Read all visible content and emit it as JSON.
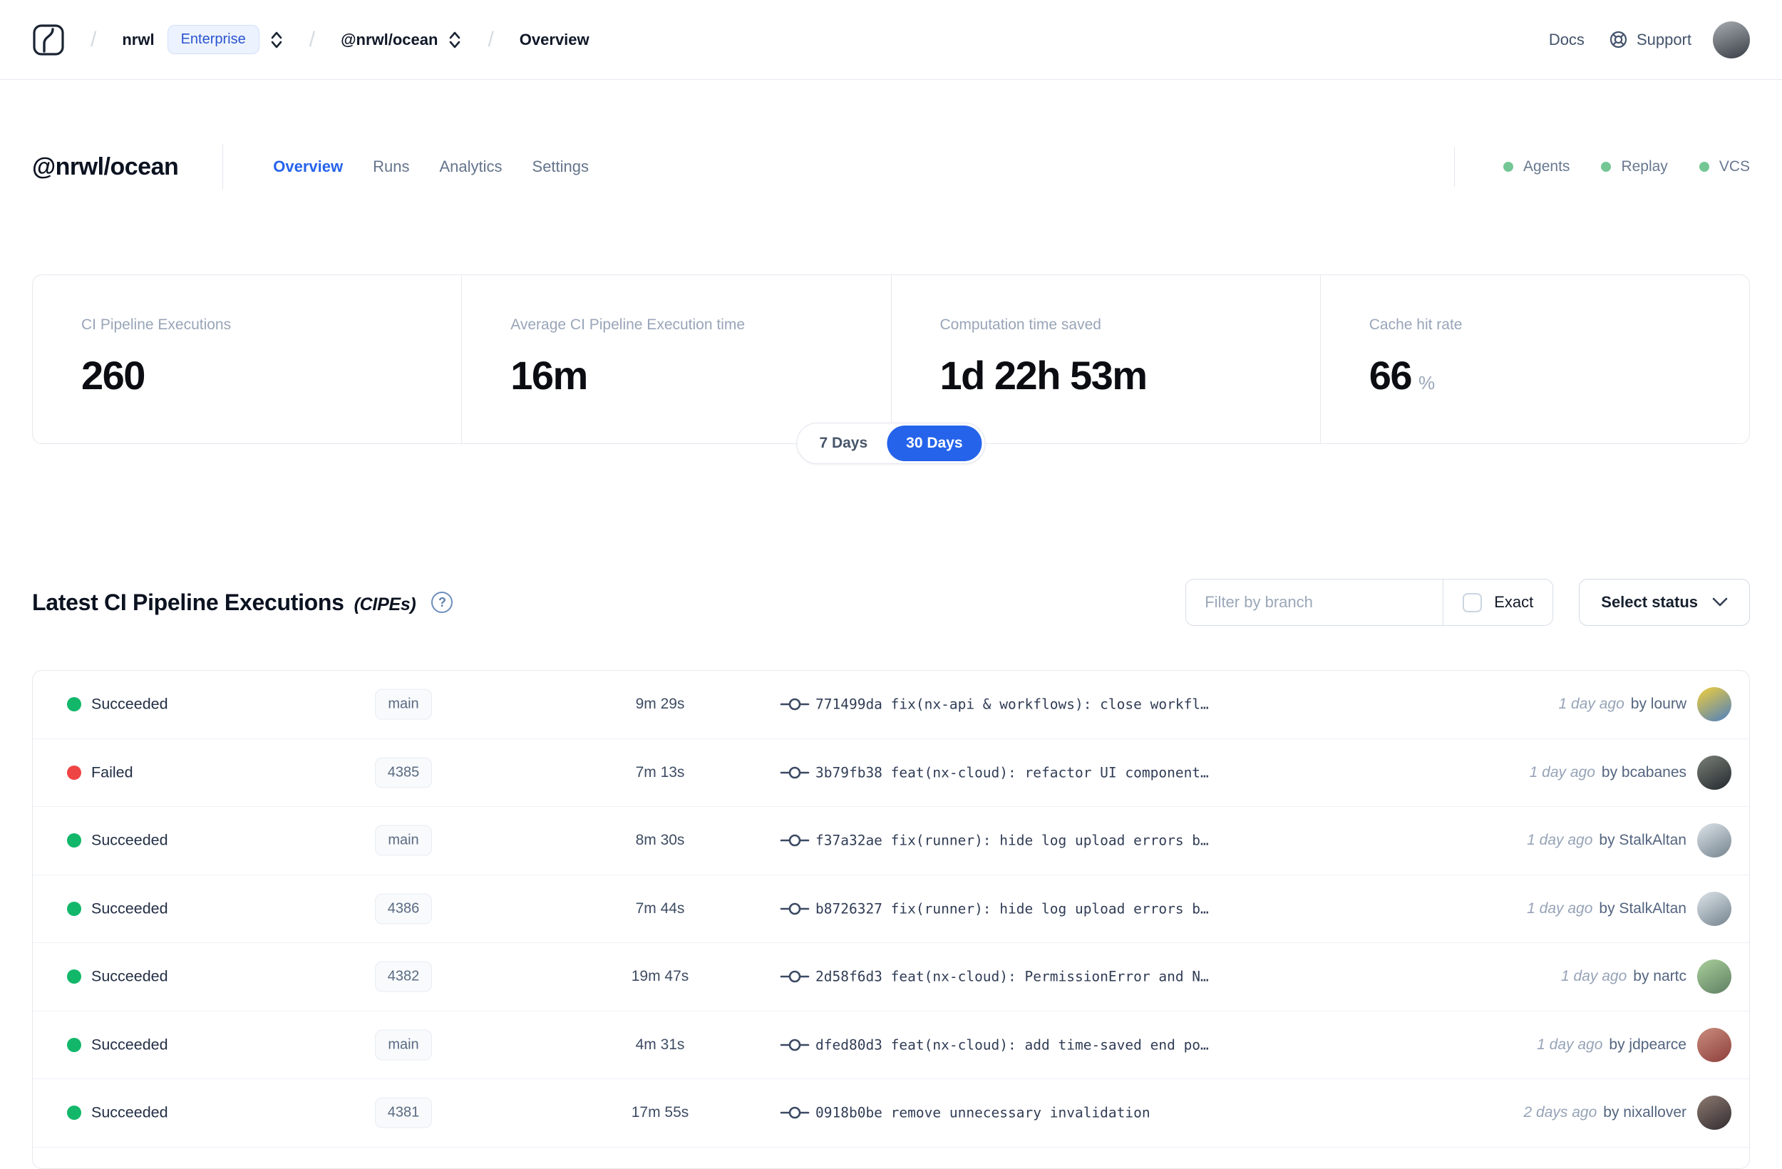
{
  "header": {
    "breadcrumb": {
      "separator": "/",
      "org": "nrwl",
      "org_badge": "Enterprise",
      "workspace": "@nrwl/ocean",
      "page": "Overview"
    },
    "docs_label": "Docs",
    "support_label": "Support",
    "avatar_colors": [
      "#a7acb1",
      "#383e45"
    ]
  },
  "workspace_header": {
    "title": "@nrwl/ocean",
    "tabs": [
      {
        "label": "Overview",
        "active": true
      },
      {
        "label": "Runs",
        "active": false
      },
      {
        "label": "Analytics",
        "active": false
      },
      {
        "label": "Settings",
        "active": false
      }
    ],
    "indicators": [
      {
        "label": "Agents"
      },
      {
        "label": "Replay"
      },
      {
        "label": "VCS"
      }
    ]
  },
  "stats": {
    "cards": [
      {
        "label": "CI Pipeline Executions",
        "value": "260",
        "suffix": ""
      },
      {
        "label": "Average CI Pipeline Execution time",
        "value": "16m",
        "suffix": ""
      },
      {
        "label": "Computation time saved",
        "value": "1d 22h 53m",
        "suffix": ""
      },
      {
        "label": "Cache hit rate",
        "value": "66",
        "suffix": "%"
      }
    ],
    "range_options": [
      "7 Days",
      "30 Days"
    ],
    "range_selected": "30 Days"
  },
  "cipe_section": {
    "title": "Latest CI Pipeline Executions",
    "title_suffix": "(CIPEs)",
    "help_icon": "?",
    "filter_placeholder": "Filter by branch",
    "exact_label": "Exact",
    "exact_checked": false,
    "status_dropdown_label": "Select status",
    "rows": [
      {
        "status": "Succeeded",
        "status_color": "green",
        "branch": "main",
        "duration": "9m 29s",
        "commit_hash": "771499da",
        "commit_message": "fix(nx-api & workflows): close workfl…",
        "time_ago": "1 day ago",
        "author": "by lourw",
        "avatar_colors": [
          "#f2cf3a",
          "#4c7ec2"
        ]
      },
      {
        "status": "Failed",
        "status_color": "red",
        "branch": "4385",
        "duration": "7m 13s",
        "commit_hash": "3b79fb38",
        "commit_message": "feat(nx-cloud): refactor UI component…",
        "time_ago": "1 day ago",
        "author": "by bcabanes",
        "avatar_colors": [
          "#7a8076",
          "#23282e"
        ]
      },
      {
        "status": "Succeeded",
        "status_color": "green",
        "branch": "main",
        "duration": "8m 30s",
        "commit_hash": "f37a32ae",
        "commit_message": "fix(runner): hide log upload errors b…",
        "time_ago": "1 day ago",
        "author": "by StalkAltan",
        "avatar_colors": [
          "#dde4e9",
          "#74838e"
        ]
      },
      {
        "status": "Succeeded",
        "status_color": "green",
        "branch": "4386",
        "duration": "7m 44s",
        "commit_hash": "b8726327",
        "commit_message": "fix(runner): hide log upload errors b…",
        "time_ago": "1 day ago",
        "author": "by StalkAltan",
        "avatar_colors": [
          "#dde4e9",
          "#74838e"
        ]
      },
      {
        "status": "Succeeded",
        "status_color": "green",
        "branch": "4382",
        "duration": "19m 47s",
        "commit_hash": "2d58f6d3",
        "commit_message": "feat(nx-cloud): PermissionError and N…",
        "time_ago": "1 day ago",
        "author": "by nartc",
        "avatar_colors": [
          "#a9cf9a",
          "#5f7f63"
        ]
      },
      {
        "status": "Succeeded",
        "status_color": "green",
        "branch": "main",
        "duration": "4m 31s",
        "commit_hash": "dfed80d3",
        "commit_message": "feat(nx-cloud): add time-saved end po…",
        "time_ago": "1 day ago",
        "author": "by jdpearce",
        "avatar_colors": [
          "#c98d7d",
          "#8e3f3c"
        ]
      },
      {
        "status": "Succeeded",
        "status_color": "green",
        "branch": "4381",
        "duration": "17m 55s",
        "commit_hash": "0918b0be",
        "commit_message": "remove unnecessary invalidation",
        "time_ago": "2 days ago",
        "author": "by nixallover",
        "avatar_colors": [
          "#8d7a70",
          "#322c31"
        ]
      }
    ]
  },
  "colors": {
    "accent_blue": "#2563eb",
    "success_green": "#12b76a",
    "failed_red": "#ef4444",
    "indicator_green": "#74c794",
    "badge_blue_text": "#2a54d0"
  }
}
